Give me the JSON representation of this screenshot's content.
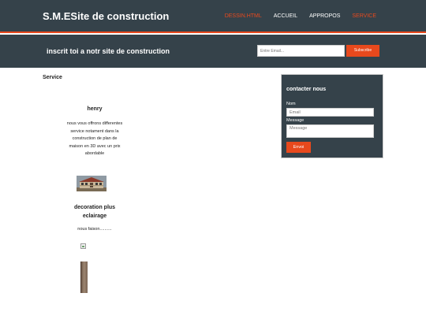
{
  "header": {
    "brand_prefix": "S.M.E",
    "brand_rest": "Site de construction",
    "nav": [
      {
        "label": "DESSIN.HTML",
        "state": "highlight"
      },
      {
        "label": "ACCUEIL",
        "state": "normal"
      },
      {
        "label": "APPROPOS",
        "state": "normal"
      },
      {
        "label": "SERVICE",
        "state": "current"
      }
    ]
  },
  "newsletter": {
    "title": "inscrit toi a notr site de construction",
    "email_placeholder": "Entre Email...",
    "button_label": "Subscribe"
  },
  "main": {
    "section_title": "Service",
    "cards": [
      {
        "name": "henry",
        "text": "nous vous offrons differentes service notament dans la construction de plan de maison en 3D avec un prix abordable",
        "image": "house-photo"
      },
      {
        "name": "decoration plus eclairage",
        "text": "nous faison..........",
        "images": [
          "broken-image",
          "interior-photo"
        ]
      }
    ]
  },
  "sidebar": {
    "title": "contacter nous",
    "name_label": "Nom",
    "email_placeholder": "Email",
    "message_label": "Message",
    "message_placeholder": "Message",
    "submit_label": "Envoi"
  },
  "colors": {
    "header_bg": "#35424a",
    "accent": "#e8491d",
    "text": "#222222"
  }
}
